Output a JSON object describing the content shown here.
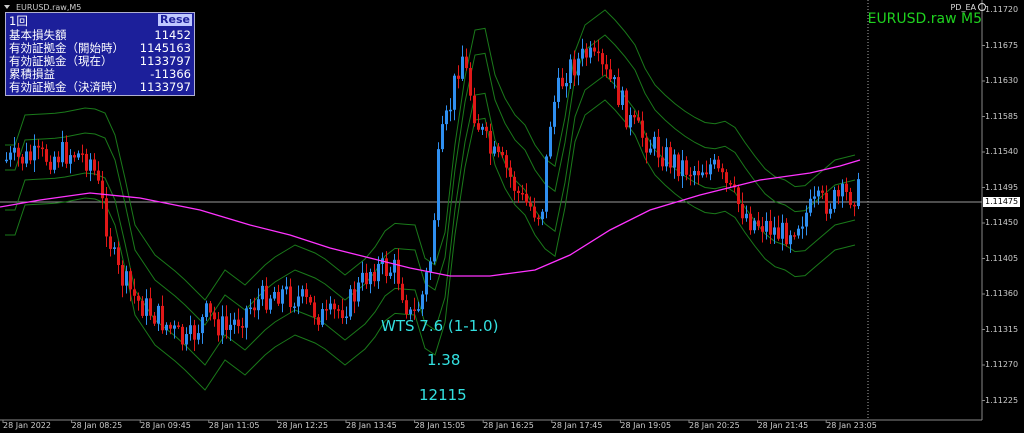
{
  "header": {
    "symbol_label": "EURUSD.raw,M5",
    "ea_name": "PD_EA",
    "big_title": "EURUSD.raw M5"
  },
  "info_panel": {
    "title": "1回",
    "reset_label": "Rese",
    "rows": [
      {
        "label": "基本損失額",
        "value": "11452"
      },
      {
        "label": "有効証拠金（開始時）",
        "value": "1145163"
      },
      {
        "label": "有効証拠金（現在）",
        "value": "1133797"
      },
      {
        "label": "累積損益",
        "value": "-11366"
      },
      {
        "label": "有効証拠金（決済時）",
        "value": "1133797"
      }
    ]
  },
  "overlay": {
    "line1": "WTS 7.6 (1-1.0)",
    "line2": "1.38",
    "line3": "12115"
  },
  "price_axis": {
    "labels": [
      "1.11720",
      "1.11675",
      "1.11630",
      "1.11585",
      "1.11540",
      "1.11495",
      "1.11450",
      "1.11405",
      "1.11360",
      "1.11315",
      "1.11270",
      "1.11225"
    ],
    "current": "1.11475"
  },
  "time_axis": {
    "labels": [
      "28 Jan 2022",
      "28 Jan 08:25",
      "28 Jan 09:45",
      "28 Jan 11:05",
      "28 Jan 12:25",
      "28 Jan 13:45",
      "28 Jan 15:05",
      "28 Jan 16:25",
      "28 Jan 17:45",
      "28 Jan 19:05",
      "28 Jan 20:25",
      "28 Jan 21:45",
      "28 Jan 23:05"
    ]
  },
  "colors": {
    "bull": "#2f8ff0",
    "bear": "#e01818",
    "ma": "#ff33ff",
    "bands": "#1a7a1a",
    "title": "#1fd11f",
    "overlay": "#33e0e0"
  }
}
